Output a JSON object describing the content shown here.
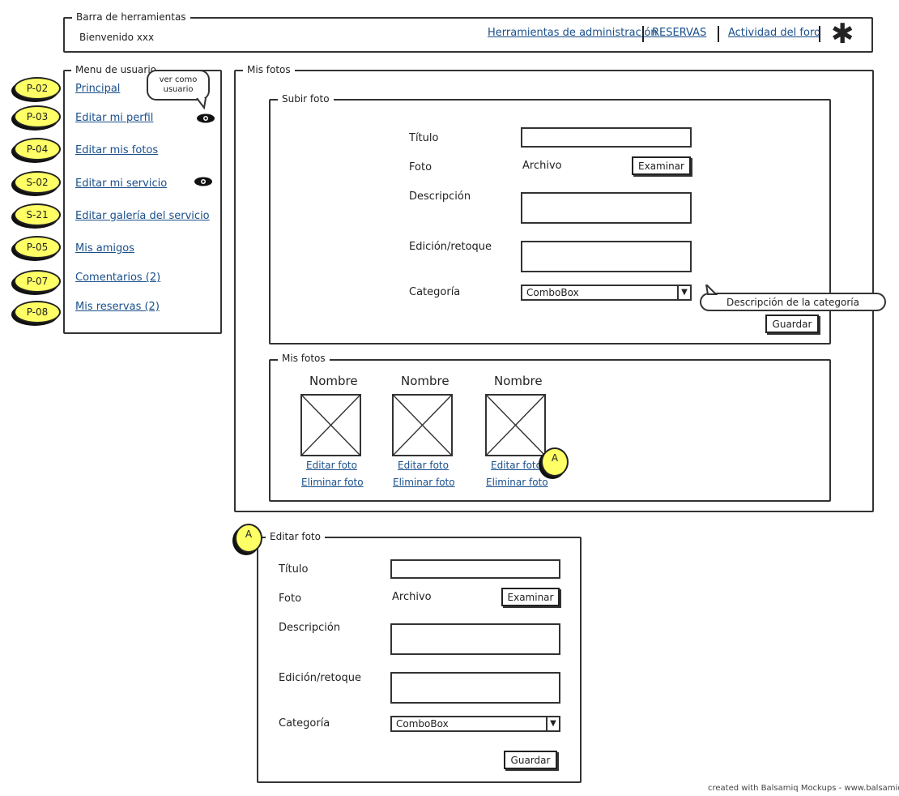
{
  "toolbar": {
    "legend": "Barra de herramientas",
    "welcome": "Bienvenido xxx",
    "links": [
      "Herramientas de administración",
      "RESERVAS",
      "Actividad del foro"
    ],
    "menu_icon": "asterisk-icon"
  },
  "user_menu": {
    "legend": "Menu de usuario",
    "items": [
      {
        "sticker": "P-02",
        "label": "Principal"
      },
      {
        "sticker": "P-03",
        "label": "Editar mi perfil"
      },
      {
        "sticker": "P-04",
        "label": "Editar mis fotos"
      },
      {
        "sticker": "S-02",
        "label": "Editar mi servicio"
      },
      {
        "sticker": "S-21",
        "label": "Editar galería del servicio"
      },
      {
        "sticker": "P-05",
        "label": "Mis amigos"
      },
      {
        "sticker": "P-07",
        "label": "Comentarios (2)"
      },
      {
        "sticker": "P-08",
        "label": "Mis reservas (2)"
      }
    ],
    "tooltip_line1": "ver como",
    "tooltip_line2": "usuario"
  },
  "photos_panel": {
    "legend": "Mis fotos",
    "upload": {
      "legend": "Subir foto",
      "title_label": "Título",
      "photo_label": "Foto",
      "file_text": "Archivo",
      "browse_label": "Examinar",
      "description_label": "Descripción",
      "edit_label": "Edición/retoque",
      "category_label": "Categoría",
      "category_value": "ComboBox",
      "category_tooltip": "Descripción de la categoría",
      "save_label": "Guardar"
    },
    "gallery": {
      "legend": "Mis fotos",
      "photos": [
        {
          "name": "Nombre",
          "edit": "Editar foto",
          "delete": "Eliminar foto"
        },
        {
          "name": "Nombre",
          "edit": "Editar foto",
          "delete": "Eliminar foto"
        },
        {
          "name": "Nombre",
          "edit": "Editar foto",
          "delete": "Eliminar foto"
        }
      ],
      "marker": "A"
    }
  },
  "edit_dialog": {
    "marker": "A",
    "legend": "Editar foto",
    "title_label": "Título",
    "photo_label": "Foto",
    "file_text": "Archivo",
    "browse_label": "Examinar",
    "description_label": "Descripción",
    "edit_label": "Edición/retoque",
    "category_label": "Categoría",
    "category_value": "ComboBox",
    "save_label": "Guardar"
  },
  "footer": "created with Balsamiq Mockups - www.balsamiq.com"
}
